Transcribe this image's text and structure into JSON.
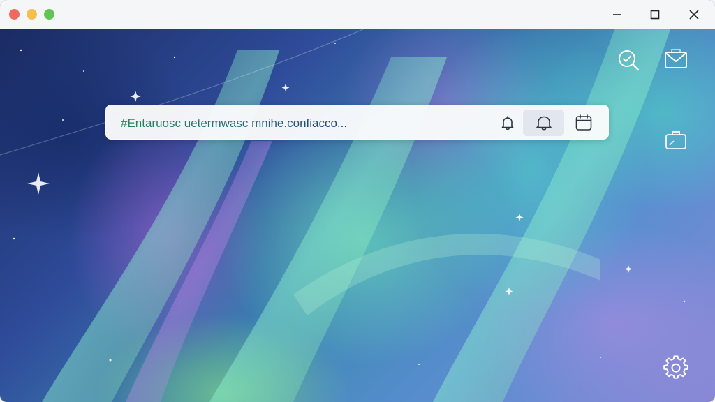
{
  "window": {
    "controls": {
      "traffic_lights": {
        "close_color": "#ec6a5e",
        "minimize_color": "#f4bf4f",
        "zoom_color": "#61c554"
      },
      "minimize_icon": "minimize-icon",
      "maximize_icon": "maximize-icon",
      "close_icon": "close-icon"
    }
  },
  "search": {
    "text": "#Entaruosc uetermwasc mnihe.confiacco...",
    "actions": [
      {
        "icon": "bell-icon"
      },
      {
        "icon": "bell-icon",
        "active": true
      },
      {
        "icon": "calendar-icon"
      }
    ]
  },
  "side_tools": [
    {
      "icon": "search-check-icon"
    },
    {
      "icon": "mail-icon"
    },
    {
      "icon": "briefcase-icon"
    },
    {
      "icon": "gear-icon"
    }
  ],
  "colors": {
    "titlebar": "#f5f6f7",
    "searchbar": "#fafbfc",
    "icon_light": "#ffffff",
    "icon_dark": "#2c3440"
  }
}
